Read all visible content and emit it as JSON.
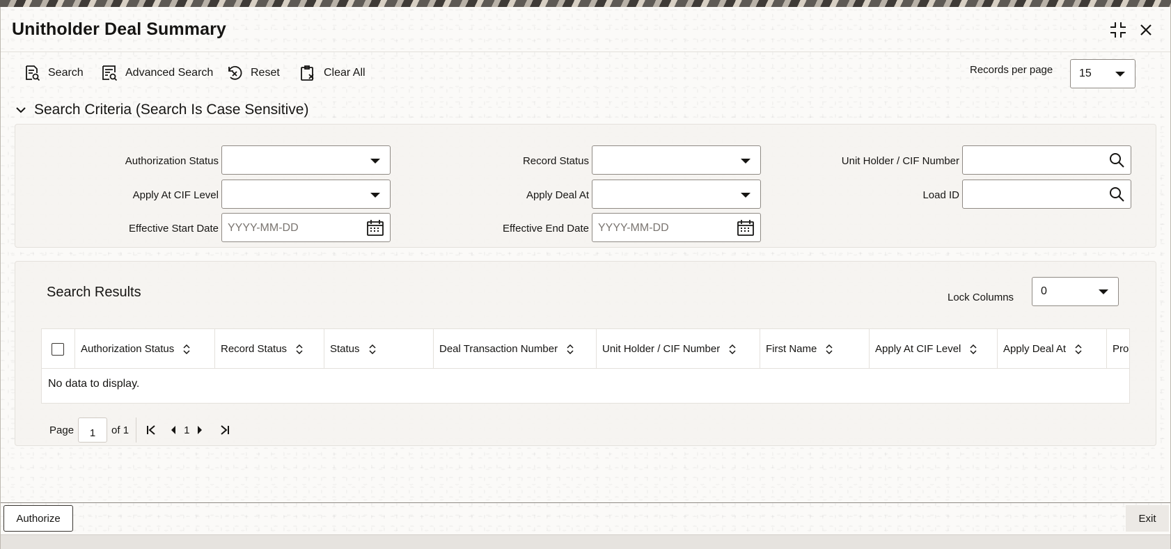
{
  "window": {
    "title": "Unitholder Deal Summary"
  },
  "toolbar": {
    "search_label": "Search",
    "advanced_search_label": "Advanced Search",
    "reset_label": "Reset",
    "clear_all_label": "Clear All",
    "records_per_page_label": "Records per page",
    "records_per_page_value": "15"
  },
  "criteria": {
    "heading": "Search Criteria (Search Is Case Sensitive)",
    "authorization_status_label": "Authorization Status",
    "record_status_label": "Record Status",
    "unit_holder_label": "Unit Holder / CIF Number",
    "apply_at_cif_label": "Apply At CIF Level",
    "apply_deal_at_label": "Apply Deal At",
    "load_id_label": "Load ID",
    "effective_start_label": "Effective Start Date",
    "effective_end_label": "Effective End Date",
    "date_placeholder": "YYYY-MM-DD"
  },
  "results": {
    "title": "Search Results",
    "lock_columns_label": "Lock Columns",
    "lock_columns_value": "0",
    "columns": [
      "Authorization Status",
      "Record Status",
      "Status",
      "Deal Transaction Number",
      "Unit Holder / CIF Number",
      "First Name",
      "Apply At CIF Level",
      "Apply Deal At",
      "Pro"
    ],
    "empty_message": "No data to display."
  },
  "pager": {
    "page_label": "Page",
    "page_value": "1",
    "of_label": "of 1",
    "current": "1"
  },
  "footer": {
    "authorize_label": "Authorize",
    "exit_label": "Exit"
  }
}
